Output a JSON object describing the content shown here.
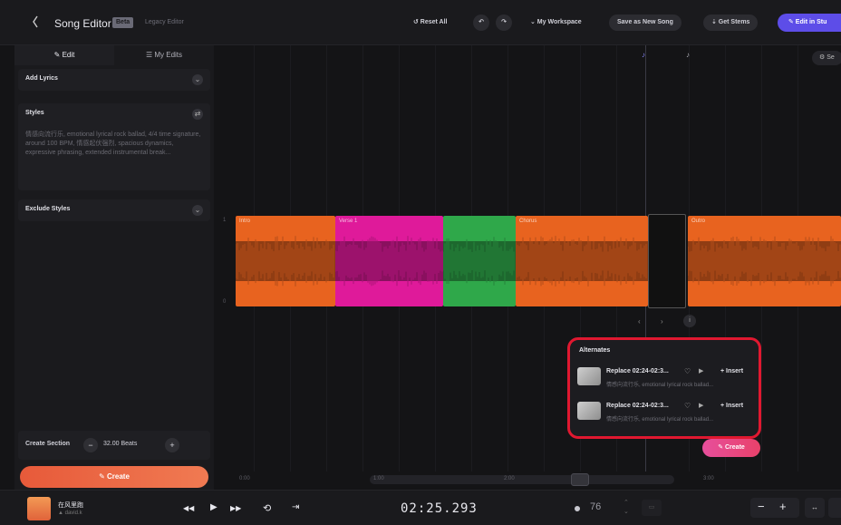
{
  "topbar": {
    "title": "Song Editor",
    "badge": "Beta",
    "legacy": "Legacy Editor",
    "reset": "↺ Reset All",
    "undo": "↶",
    "redo": "↷",
    "workspace": "⌄ My Workspace",
    "save_new": "Save as New Song",
    "get_stems": "⇣ Get Stems",
    "edit_in": "✎ Edit in Stu"
  },
  "sidebar": {
    "tab_edit": "✎ Edit",
    "tab_my_edits": "☰ My Edits",
    "add_lyrics": "Add Lyrics",
    "styles": "Styles",
    "styles_text": "情感向流行乐, emotional lyrical rock ballad, 4/4 time signature, around 100 BPM, 情感起伏强烈, spacious dynamics, expressive phrasing, extended instrumental break...",
    "exclude_styles": "Exclude Styles",
    "create_section_label": "Create Section",
    "create_section_minus": "−",
    "create_section_length": "32.00 Beats",
    "create_section_plus": "+",
    "create_btn": "✎ Create"
  },
  "editor": {
    "marker_1": "♪",
    "marker_2": "♪",
    "settings_btn": "⚙ Se",
    "ruler_top": "1",
    "ruler_bottom": "0",
    "clips": [
      {
        "label": "Intro",
        "color": "#e8631f"
      },
      {
        "label": "Verse 1",
        "color": "#df1a9a"
      },
      {
        "label": "",
        "color": "#2fa84a"
      },
      {
        "label": "Chorus",
        "color": "#e8631f"
      },
      {
        "label": "Outro",
        "color": "#e8631f"
      }
    ],
    "nav_prev": "‹",
    "nav_next": "›",
    "nav_info": "i",
    "timeline_labels": [
      "0:00",
      "1:00",
      "2:00",
      "3:00"
    ]
  },
  "alternates": {
    "title": "Alternates",
    "items": [
      {
        "name": "Replace 02:24-02:3...",
        "desc": "情感向流行乐, emotional lyrical rock ballad...",
        "insert": "+ Insert"
      },
      {
        "name": "Replace 02:24-02:3...",
        "desc": "情感向流行乐, emotional lyrical rock ballad...",
        "insert": "+ Insert"
      }
    ],
    "heart": "♡",
    "play": "▶",
    "create": "✎ Create"
  },
  "player": {
    "song_name": "在风里跑",
    "artist": "▲ david.k",
    "prev": "◀◀",
    "play": "▶",
    "next": "▶▶",
    "loop": "⟲",
    "skip": "⇥",
    "timecode": "02:25.293",
    "bpm": "76",
    "bpm_stepper": "⌃\n⌄",
    "loop_region": "▭",
    "zoom_out": "−",
    "zoom_in": "+",
    "fit": "↔"
  }
}
